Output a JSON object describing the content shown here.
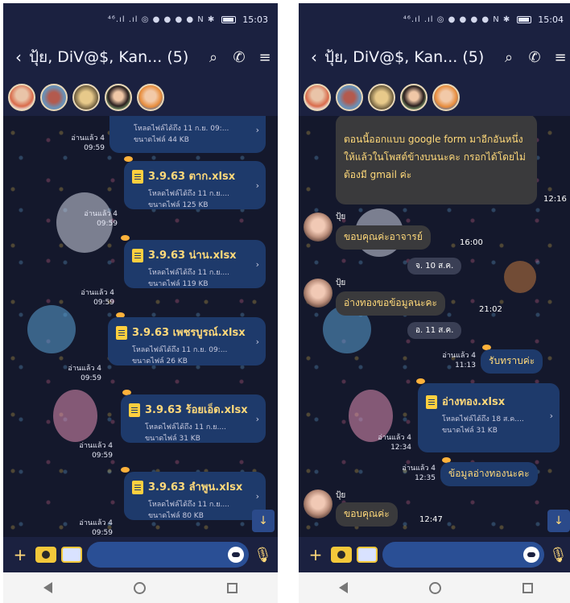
{
  "left": {
    "status": {
      "icons": "⁴⁶.ıl .ıl ◎ ● ● ● ●  N ✱",
      "time": "15:03"
    },
    "title": "ปุ้ย, DiV@$, Kan... (5)",
    "files": [
      {
        "name": "",
        "sub": "โหลดไฟล์ได้ถึง 11 ก.ย. 09:...",
        "size": "ขนาดไฟล์ 44 KB",
        "read": "อ่านแล้ว 4",
        "time": "09:59"
      },
      {
        "name": "3.9.63 ตาก.xlsx",
        "sub": "โหลดไฟล์ได้ถึง 11 ก.ย....",
        "size": "ขนาดไฟล์ 125 KB",
        "read": "อ่านแล้ว 4",
        "time": "09:59"
      },
      {
        "name": "3.9.63 น่าน.xlsx",
        "sub": "โหลดไฟล์ได้ถึง 11 ก.ย....",
        "size": "ขนาดไฟล์ 119 KB",
        "read": "อ่านแล้ว 4",
        "time": "09:59"
      },
      {
        "name": "3.9.63 เพชรบูรณ์.xlsx",
        "sub": "โหลดไฟล์ได้ถึง 11 ก.ย. 09:...",
        "size": "ขนาดไฟล์ 26 KB",
        "read": "อ่านแล้ว 4",
        "time": "09:59"
      },
      {
        "name": "3.9.63 ร้อยเอ็ด.xlsx",
        "sub": "โหลดไฟล์ได้ถึง 11 ก.ย....",
        "size": "ขนาดไฟล์ 31 KB",
        "read": "อ่านแล้ว 4",
        "time": "09:59"
      },
      {
        "name": "3.9.63 ลำพูน.xlsx",
        "sub": "โหลดไฟล์ได้ถึง 11 ก.ย....",
        "size": "ขนาดไฟล์ 80 KB",
        "read": "อ่านแล้ว 4",
        "time": "09:59"
      }
    ]
  },
  "right": {
    "status": {
      "icons": "⁴⁶.ıl .ıl ◎ ● ● ● ●  N ✱",
      "time": "15:04"
    },
    "title": "ปุ้ย, DiV@$, Kan... (5)",
    "top_message": "ตอนนี้ออกแบบ google form มาอีกอันหนึ่งให้แล้วในโพสต์ข้างบนนะคะ กรอกได้โดยไม่ต้องมี gmail ค่ะ",
    "top_time": "12:16",
    "sender": "ปุ้ย",
    "msg1": "ขอบคุณค่ะอาจารย์",
    "msg1_time": "16:00",
    "date1": "จ. 10 ส.ค.",
    "msg2": "อ่างทองขอข้อมูลนะคะ",
    "msg2_time": "21:02",
    "date2": "อ. 11 ส.ค.",
    "sent1": "รับทราบค่ะ",
    "sent1_read": "อ่านแล้ว 4",
    "sent1_time": "11:13",
    "file": {
      "name": "อ่างทอง.xlsx",
      "sub": "โหลดไฟล์ได้ถึง 18 ส.ค....",
      "size": "ขนาดไฟล์ 31 KB",
      "read": "อ่านแล้ว 4",
      "time": "12:34"
    },
    "sent2": "ข้อมูลอ่างทองนะคะ",
    "sent2_read": "อ่านแล้ว 4",
    "sent2_time": "12:35",
    "msg3": "ขอบคุณค่ะ",
    "msg3_time": "12:47"
  },
  "icons": {
    "back": "chevron-left",
    "search": "search",
    "call": "phone",
    "menu": "hamburger",
    "add": "plus",
    "camera": "camera",
    "gallery": "image",
    "emoji": "emoji",
    "mic": "microphone",
    "scroll": "arrow-down"
  },
  "colors": {
    "bubble_file": "#1e3a6b",
    "bubble_text": "#3a3a3c",
    "accent_text": "#ffd97a",
    "header": "#1b2140"
  }
}
